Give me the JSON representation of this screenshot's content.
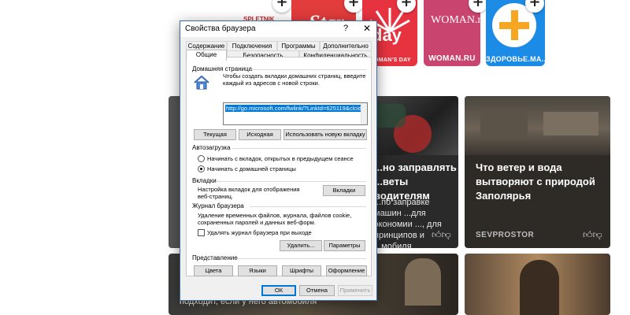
{
  "tiles": [
    {
      "caption": "",
      "logo": "SPLETNIK"
    },
    {
      "caption": "",
      "logo": "Star"
    },
    {
      "caption": "WOMAN'S DAY",
      "logo": "day"
    },
    {
      "caption": "WOMAN.RU",
      "logo": "WOMAN.ru"
    },
    {
      "caption": "ЗДОРОВЬЕ.МА...",
      "logo": "+"
    }
  ],
  "cards": {
    "middle": {
      "title": "...но заправлять ...веты водителям",
      "text": "...по заправке машин ...для экономии ..., для принципов и ...мобиля"
    },
    "right": {
      "title": "Что ветер и вода вытворяют с природой Заполярья",
      "source": "SEVPROSTOR"
    },
    "bottom_left": {
      "text": "подходит, если у него автомобиля"
    }
  },
  "dialog": {
    "title": "Свойства браузера",
    "help": "?",
    "close": "✕",
    "tabs_row1": [
      "Содержание",
      "Подключения",
      "Программы",
      "Дополнительно"
    ],
    "tabs_row2": [
      "Общие",
      "Безопасность",
      "Конфиденциальность"
    ],
    "home": {
      "heading": "Домашняя страница",
      "description": "Чтобы создать вкладки домашних страниц, введите каждый из адресов с новой строки.",
      "url": "http://go.microsoft.com/fwlink/?LinkId=625119&clcid",
      "btn_current": "Текущая",
      "btn_default": "Исходная",
      "btn_newtab": "Использовать новую вкладку"
    },
    "startup": {
      "heading": "Автозагрузка",
      "option1": "Начинать с вкладок, открытых в предыдущем сеансе",
      "option2": "Начинать с домашней страницы",
      "selected": "option2"
    },
    "tabs_section": {
      "heading": "Вкладки",
      "description": "Настройка вкладок для отображения веб-страниц.",
      "button": "Вкладки"
    },
    "history": {
      "heading": "Журнал браузера",
      "description": "Удаление временных файлов, журнала, файлов cookie, сохраненных паролей и данных веб-форм.",
      "checkbox": "Удалять журнал браузера при выходе",
      "checked": false,
      "btn_delete": "Удалить...",
      "btn_params": "Параметры"
    },
    "appearance": {
      "heading": "Представление",
      "btn_colors": "Цвета",
      "btn_languages": "Языки",
      "btn_fonts": "Шрифты",
      "btn_design": "Оформление"
    },
    "footer": {
      "ok": "ОК",
      "cancel": "Отмена",
      "apply": "Применить"
    }
  },
  "colors": {
    "tile_red": "#e7333f",
    "tile_pink": "#c94570",
    "tile_blue": "#1b8be6",
    "accent": "#0078d7"
  }
}
